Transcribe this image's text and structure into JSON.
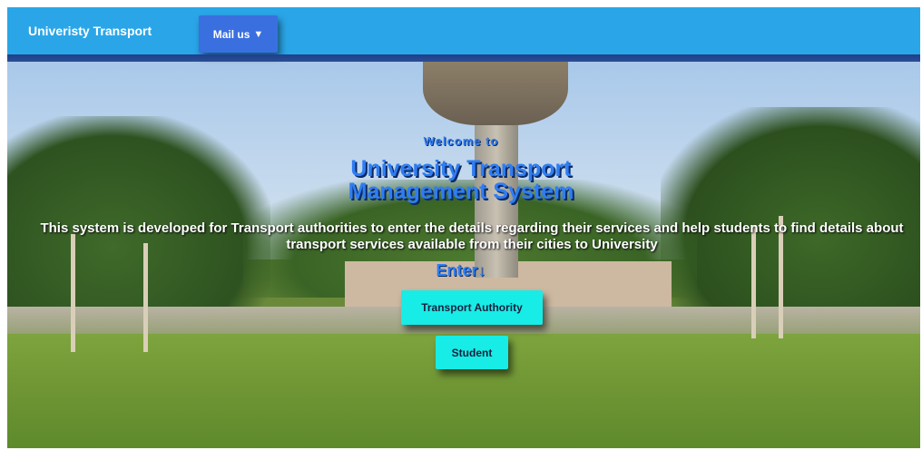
{
  "navbar": {
    "brand": "Univeristy Transport",
    "mail_label": "Mail us",
    "mail_arrow": "▼"
  },
  "hero": {
    "welcome": "Welcome to",
    "title_line1": "University Transport",
    "title_line2": "Management System",
    "description": "This system is developed for Transport authorities to enter the details regarding their services and help students to find details about transport services available from their cities to University",
    "enter_label": "Enter",
    "enter_arrow": "↓"
  },
  "buttons": {
    "transport_authority": "Transport Authority",
    "student": "Student"
  },
  "colors": {
    "navbar": "#2aa6e8",
    "mail_button": "#3a6fe0",
    "heading_blue": "#2f7df2",
    "action_button": "#17ece6"
  },
  "icons": {
    "mail_dropdown": "triangle-down",
    "enter": "arrow-down"
  }
}
